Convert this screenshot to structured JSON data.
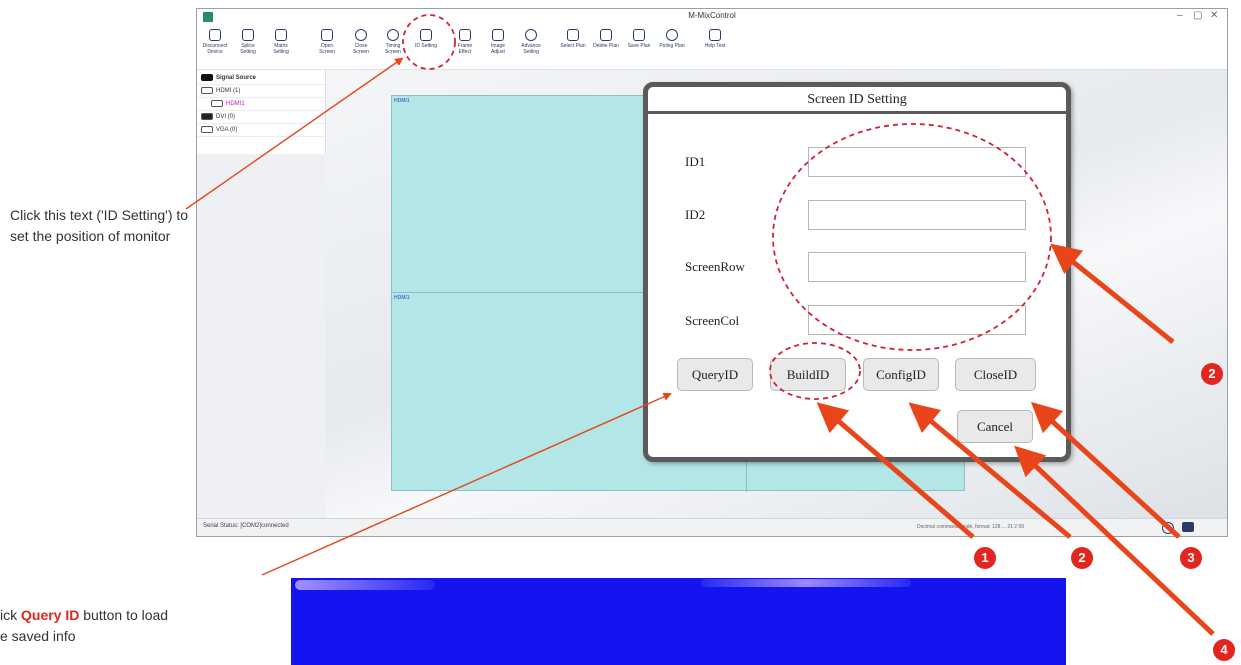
{
  "app": {
    "title": "M-MixControl",
    "window_controls": [
      "–",
      "▢",
      "✕"
    ],
    "toolbar": [
      {
        "label": "Disconnect Device",
        "icon": "link-icon"
      },
      {
        "label": "Splice Setting",
        "icon": "splice-grid-icon"
      },
      {
        "label": "Matrix Setting",
        "icon": "matrix-grid-icon"
      },
      {
        "label": "Open Screen",
        "icon": "monitor-icon"
      },
      {
        "label": "Close Screen",
        "icon": "power-icon"
      },
      {
        "label": "Timing Screen",
        "icon": "clock-icon"
      },
      {
        "label": "ID Setting",
        "icon": "id-card-icon"
      },
      {
        "label": "Frame Effect",
        "icon": "frame-icon"
      },
      {
        "label": "Image Adjust",
        "icon": "image-icon"
      },
      {
        "label": "Advance Setting",
        "icon": "gear-icon"
      },
      {
        "label": "Select Plan",
        "icon": "select-plan-icon"
      },
      {
        "label": "Delete Plan",
        "icon": "delete-plan-icon"
      },
      {
        "label": "Save Plan",
        "icon": "save-icon"
      },
      {
        "label": "Poling Plan",
        "icon": "refresh-icon"
      },
      {
        "label": "Help Text",
        "icon": "help-icon"
      }
    ],
    "signal_source": {
      "header": "Signal Source",
      "items": [
        {
          "label": "HDMI (1)"
        },
        {
          "label": "HDMI1"
        },
        {
          "label": "DVI (0)"
        },
        {
          "label": "VGA (0)"
        }
      ]
    },
    "canvas": {
      "label_top": "HDMI1",
      "label_mid": "HDMI1"
    },
    "status": {
      "left": "Serial Status: [COM2]connected",
      "right": "Decimal command mode, format: 128 ... 21 2 99"
    }
  },
  "dialog": {
    "title": "Screen ID Setting",
    "fields": [
      {
        "label": "ID1",
        "value": ""
      },
      {
        "label": "ID2",
        "value": ""
      },
      {
        "label": "ScreenRow",
        "value": ""
      },
      {
        "label": "ScreenCol",
        "value": ""
      }
    ],
    "buttons": {
      "query": "QueryID",
      "build": "BuildID",
      "config": "ConfigID",
      "close": "CloseID",
      "cancel": "Cancel"
    }
  },
  "annotations": {
    "id_setting_note": "Click this text ('ID Setting') to set the position of monitor",
    "query_note_prefix": "ick ",
    "query_note_highlight": "Query ID",
    "query_note_suffix": " button to load",
    "query_note_line2": "e saved info",
    "badges": {
      "fields": "2",
      "build": "1",
      "config": "2",
      "close": "3",
      "cancel": "4"
    },
    "accent_color": "#e0261e",
    "highlight_color": "#e0261e"
  }
}
